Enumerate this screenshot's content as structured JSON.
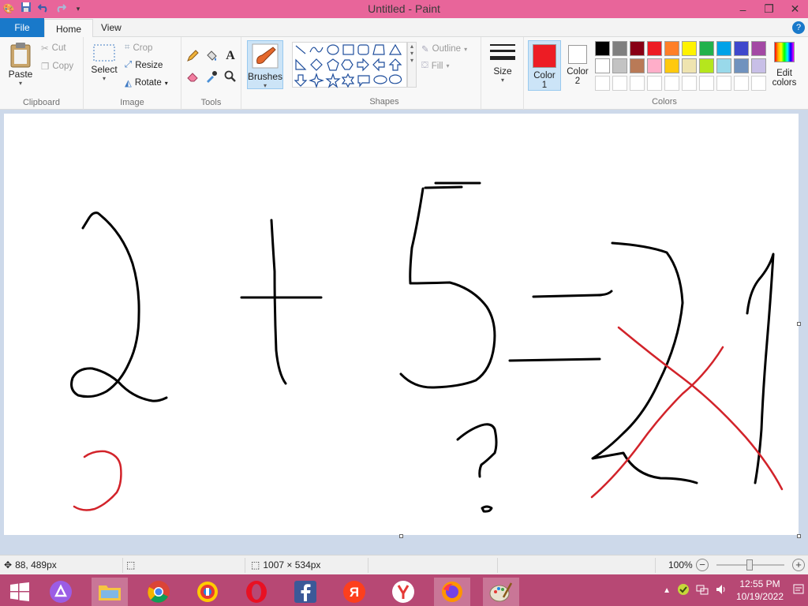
{
  "window": {
    "title": "Untitled - Paint"
  },
  "window_controls": {
    "minimize": "–",
    "maximize": "❐",
    "close": "✕"
  },
  "tabs": {
    "file": "File",
    "home": "Home",
    "view": "View"
  },
  "clipboard": {
    "paste": "Paste",
    "cut": "Cut",
    "copy": "Copy",
    "label": "Clipboard"
  },
  "image": {
    "select": "Select",
    "crop": "Crop",
    "resize": "Resize",
    "rotate": "Rotate",
    "label": "Image"
  },
  "tools": {
    "label": "Tools"
  },
  "brushes": {
    "label": "Brushes"
  },
  "shapes": {
    "outline": "Outline",
    "fill": "Fill",
    "label": "Shapes"
  },
  "size": {
    "label": "Size"
  },
  "colors": {
    "color1_line1": "Color",
    "color1_line2": "1",
    "color2_line1": "Color",
    "color2_line2": "2",
    "edit_line1": "Edit",
    "edit_line2": "colors",
    "label": "Colors",
    "color1_value": "#ed1c24",
    "color2_value": "#ffffff",
    "palette_row1": [
      "#000000",
      "#7f7f7f",
      "#880015",
      "#ed1c24",
      "#ff7f27",
      "#fff200",
      "#22b14c",
      "#00a2e8",
      "#3f48cc",
      "#a349a4"
    ],
    "palette_row2": [
      "#ffffff",
      "#c3c3c3",
      "#b97a57",
      "#ffaec9",
      "#ffc90e",
      "#efe4b0",
      "#b5e61d",
      "#99d9ea",
      "#7092be",
      "#c8bfe7"
    ]
  },
  "canvas": {
    "stroke_black": "#000000",
    "stroke_red": "#d2232a"
  },
  "status": {
    "cursor_pos": "88, 489px",
    "canvas_size": "1007 × 534px",
    "zoom": "100%"
  },
  "taskbar": {
    "time": "12:55 PM",
    "date": "10/19/2022"
  }
}
